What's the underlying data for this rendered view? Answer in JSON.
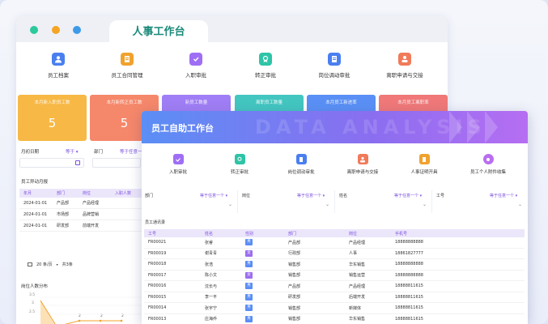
{
  "window_dots": [
    {
      "color": "#2cc99c"
    },
    {
      "color": "#f5a524"
    },
    {
      "color": "#3d9ae8"
    }
  ],
  "back": {
    "tab_title": "人事工作台",
    "nav": [
      {
        "label": "员工档案",
        "icon": "person-icon",
        "color": "#4a7ff0"
      },
      {
        "label": "员工合同管理",
        "icon": "contract-icon",
        "color": "#f0a22e"
      },
      {
        "label": "入职审批",
        "icon": "shield-check-icon",
        "color": "#9f6ef5"
      },
      {
        "label": "转正审批",
        "icon": "badge-icon",
        "color": "#2ec4a7"
      },
      {
        "label": "岗位调动审批",
        "icon": "document-icon",
        "color": "#4a7ff0"
      },
      {
        "label": "离职申请与交接",
        "icon": "handover-icon",
        "color": "#f07a5a"
      }
    ],
    "stats": [
      {
        "title": "本月新入职员工数",
        "value": "5",
        "color": "#f7b845"
      },
      {
        "title": "本月新转正员工数",
        "value": "5",
        "color": "#f5876a"
      },
      {
        "title": "新员工数量",
        "value": "",
        "color": "#a07ef5"
      },
      {
        "title": "离职员工数量",
        "value": "",
        "color": "#43c6c0"
      },
      {
        "title": "本月员工新进率",
        "value": "",
        "color": "#5a90f5"
      },
      {
        "title": "本月员工离职率",
        "value": "",
        "color": "#f07878"
      }
    ],
    "filters": [
      {
        "label": "月初日期",
        "op": "等于 ▾"
      },
      {
        "label": "部门",
        "op": "等于任意一个 ▾"
      }
    ],
    "change_table": {
      "title": "员工异动月报",
      "headers": [
        "年月",
        "部门",
        "岗位",
        "入职人数"
      ],
      "rows": [
        [
          "2024-01-01",
          "产品部",
          "产品经理",
          ""
        ],
        [
          "2024-01-01",
          "市场部",
          "品牌营销",
          ""
        ],
        [
          "2024-01-01",
          "研发部",
          "前端开发",
          ""
        ]
      ],
      "pager_size": "20 条/页",
      "pager_total": "共3条"
    },
    "chart": {
      "title": "岗位人数分布",
      "y_ticks": [
        "3.5",
        "3",
        "2.5"
      ],
      "data_labels": [
        "2",
        "2",
        "2"
      ]
    }
  },
  "front": {
    "title": "员工自助工作台",
    "watermark": "DATA ANALYSIS",
    "nav": [
      {
        "label": "入职审批",
        "icon": "shield-check-icon",
        "color": "#9f6ef5"
      },
      {
        "label": "转正审批",
        "icon": "badge-icon",
        "color": "#2ec4a7"
      },
      {
        "label": "岗位调动审批",
        "icon": "document-icon",
        "color": "#4a7ff0"
      },
      {
        "label": "离职申请与交接",
        "icon": "handover-icon",
        "color": "#f07a5a"
      },
      {
        "label": "人事证明开具",
        "icon": "certificate-icon",
        "color": "#f0a22e"
      },
      {
        "label": "员工个人附件收集",
        "icon": "attachment-icon",
        "color": "#b96ef0"
      }
    ],
    "filters": [
      {
        "label": "部门",
        "op": "等于任意一个 ▾"
      },
      {
        "label": "岗位",
        "op": "等于任意一个 ▾"
      },
      {
        "label": "姓名",
        "op": "等于任意一个 ▾"
      },
      {
        "label": "工号",
        "op": "等于任意一个 ▾"
      }
    ],
    "contacts": {
      "title": "员工通讯录",
      "headers": [
        "工号",
        "姓名",
        "性别",
        "部门",
        "岗位",
        "手机号"
      ],
      "rows": [
        [
          "FR00021",
          "张睿",
          "男",
          "产品部",
          "产品经理",
          "18888888888"
        ],
        [
          "FR00019",
          "谢青青",
          "女",
          "行政部",
          "人事",
          "18861827777"
        ],
        [
          "FR00018",
          "张浩",
          "男",
          "销售部",
          "华东销售",
          "18888888888"
        ],
        [
          "FR00017",
          "陈小文",
          "女",
          "销售部",
          "销售运营",
          "18888888888"
        ],
        [
          "FR00016",
          "沈长与",
          "男",
          "产品部",
          "产品经理",
          "18888811615"
        ],
        [
          "FR00015",
          "李一平",
          "男",
          "研发部",
          "后端开发",
          "18888811615"
        ],
        [
          "FR00014",
          "张宇宁",
          "男",
          "销售部",
          "新媒体",
          "18888811615"
        ],
        [
          "FR00013",
          "庄海乔",
          "男",
          "销售部",
          "华东销售",
          "18888811615"
        ]
      ],
      "gender_colors": {
        "男": "#5b8ef5",
        "女": "#9b6ef0"
      }
    }
  }
}
